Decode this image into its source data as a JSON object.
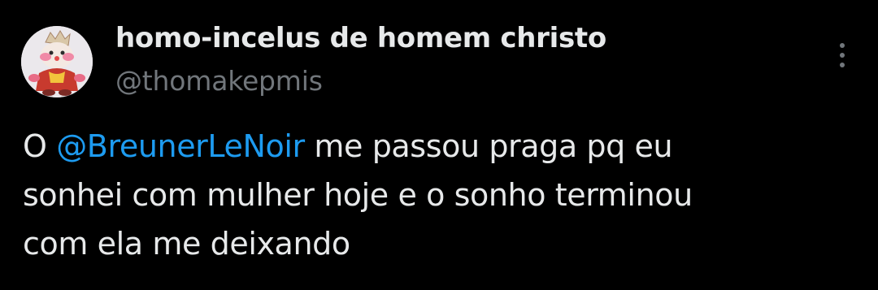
{
  "tweet": {
    "author": {
      "display_name": "homo-incelus de homem christo",
      "handle": "@thomakepmis",
      "avatar_icon": "clown-figure-avatar"
    },
    "more_icon": "vertical-ellipsis-icon",
    "text": {
      "line1_prefix": "O ",
      "mention": "@BreunerLeNoir",
      "line1_suffix": " me passou praga pq eu",
      "line2": "sonhei com mulher hoje e o sonho terminou",
      "line3": "com ela me deixando"
    }
  },
  "colors": {
    "background": "#000000",
    "primary_text": "#e7e9ea",
    "secondary_text": "#71767b",
    "link": "#1d9bf0"
  }
}
